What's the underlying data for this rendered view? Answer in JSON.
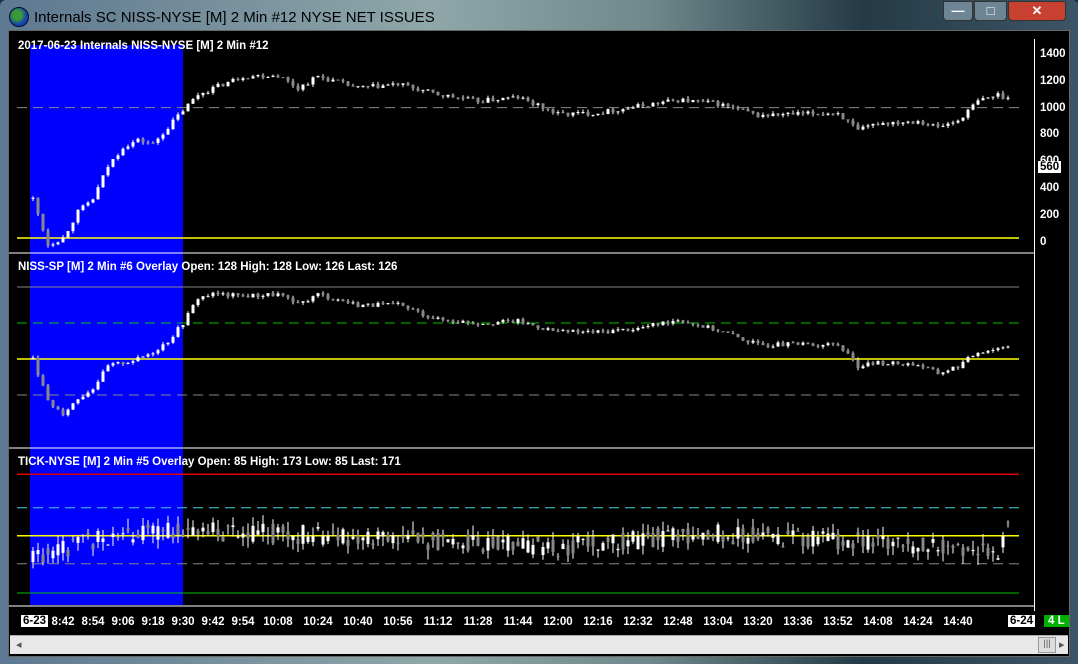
{
  "window": {
    "title": "Internals  SC NISS-NYSE [M]  2 Min   #12  NYSE NET ISSUES",
    "minimize": "—",
    "maximize": "□",
    "close": "✕"
  },
  "panels": [
    {
      "header": "2017-06-23 Internals NISS-NYSE [M]  2 Min   #12",
      "axis_ticks": [
        "1400",
        "1200",
        "1000",
        "800",
        "600",
        "400",
        "200",
        "0"
      ],
      "last_value": "560"
    },
    {
      "header": "NISS-SP [M]  2 Min   #6 Overlay  Open: 128  High: 128  Low: 126  Last: 126"
    },
    {
      "header": "TICK-NYSE [M]  2 Min   #5 Overlay  Open: 85  High: 173  Low: 85  Last: 171"
    }
  ],
  "time_axis": {
    "start_date": "6-23",
    "end_date": "6-24",
    "labels": [
      "8:42",
      "8:54",
      "9:06",
      "9:18",
      "9:30",
      "9:42",
      "9:54",
      "10:08",
      "10:24",
      "10:40",
      "10:56",
      "11:12",
      "11:28",
      "11:44",
      "12:00",
      "12:16",
      "12:32",
      "12:48",
      "13:04",
      "13:20",
      "13:36",
      "13:52",
      "14:08",
      "14:24",
      "14:40"
    ],
    "status": "4 L"
  },
  "colors": {
    "session_highlight": "#0000ff",
    "zero_line": "#ffff00",
    "green_ref": "#00c000",
    "red_ref": "#e00000",
    "cyan_ref": "#40d0e0",
    "candle": "#ffffff"
  },
  "chart_data": [
    {
      "type": "candlestick",
      "title": "NISS-NYSE",
      "ylim": [
        -100,
        1450
      ],
      "ref_lines": {
        "solid_yellow": 0,
        "dashed_gray": 1000
      },
      "keypoints": [
        [
          "8:30",
          300
        ],
        [
          "8:36",
          -50
        ],
        [
          "8:42",
          0
        ],
        [
          "8:48",
          200
        ],
        [
          "8:54",
          300
        ],
        [
          "9:00",
          550
        ],
        [
          "9:06",
          700
        ],
        [
          "9:12",
          750
        ],
        [
          "9:18",
          720
        ],
        [
          "9:24",
          850
        ],
        [
          "9:30",
          980
        ],
        [
          "9:36",
          1100
        ],
        [
          "9:42",
          1150
        ],
        [
          "9:54",
          1240
        ],
        [
          "10:08",
          1250
        ],
        [
          "10:16",
          1150
        ],
        [
          "10:24",
          1240
        ],
        [
          "10:40",
          1150
        ],
        [
          "10:56",
          1180
        ],
        [
          "11:12",
          1100
        ],
        [
          "11:28",
          1050
        ],
        [
          "11:44",
          1080
        ],
        [
          "12:00",
          950
        ],
        [
          "12:16",
          960
        ],
        [
          "12:32",
          1010
        ],
        [
          "12:48",
          1060
        ],
        [
          "13:04",
          1030
        ],
        [
          "13:20",
          940
        ],
        [
          "13:36",
          950
        ],
        [
          "13:52",
          960
        ],
        [
          "14:00",
          820
        ],
        [
          "14:08",
          880
        ],
        [
          "14:24",
          900
        ],
        [
          "14:32",
          850
        ],
        [
          "14:40",
          900
        ],
        [
          "14:48",
          1050
        ],
        [
          "14:56",
          1100
        ],
        [
          "15:00",
          1070
        ]
      ]
    },
    {
      "type": "candlestick",
      "title": "NISS-SP",
      "ylim": [
        -250,
        250
      ],
      "ref_lines": {
        "gray_top": 200,
        "dashed_green": 100,
        "solid_yellow": 0,
        "dashed_gray": -100
      },
      "keypoints": [
        [
          "8:30",
          0
        ],
        [
          "8:36",
          -120
        ],
        [
          "8:42",
          -150
        ],
        [
          "8:48",
          -110
        ],
        [
          "8:54",
          -80
        ],
        [
          "9:00",
          -20
        ],
        [
          "9:06",
          -10
        ],
        [
          "9:12",
          0
        ],
        [
          "9:18",
          20
        ],
        [
          "9:24",
          50
        ],
        [
          "9:30",
          100
        ],
        [
          "9:36",
          170
        ],
        [
          "9:42",
          180
        ],
        [
          "9:54",
          175
        ],
        [
          "10:08",
          180
        ],
        [
          "10:16",
          150
        ],
        [
          "10:24",
          180
        ],
        [
          "10:40",
          150
        ],
        [
          "10:56",
          150
        ],
        [
          "11:12",
          110
        ],
        [
          "11:28",
          100
        ],
        [
          "11:44",
          105
        ],
        [
          "12:00",
          75
        ],
        [
          "12:16",
          75
        ],
        [
          "12:32",
          85
        ],
        [
          "12:48",
          110
        ],
        [
          "13:04",
          80
        ],
        [
          "13:20",
          40
        ],
        [
          "13:36",
          40
        ],
        [
          "13:52",
          40
        ],
        [
          "14:00",
          -20
        ],
        [
          "14:08",
          -10
        ],
        [
          "14:24",
          -15
        ],
        [
          "14:32",
          -40
        ],
        [
          "14:40",
          -20
        ],
        [
          "14:48",
          20
        ],
        [
          "14:56",
          30
        ],
        [
          "15:00",
          40
        ]
      ]
    },
    {
      "type": "candlestick",
      "title": "TICK-NYSE",
      "ylim": [
        -1200,
        1300
      ],
      "ref_lines": {
        "solid_red": 1100,
        "dashed_cyan": 500,
        "solid_yellow": 0,
        "dashed_gray": -500
      },
      "keypoints": [
        [
          "8:30",
          -400
        ],
        [
          "9:00",
          0
        ],
        [
          "9:30",
          100
        ],
        [
          "10:30",
          0
        ],
        [
          "12:00",
          -200
        ],
        [
          "13:00",
          50
        ],
        [
          "14:00",
          -100
        ],
        [
          "14:56",
          -300
        ],
        [
          "15:00",
          171
        ]
      ],
      "noise": 350
    }
  ]
}
